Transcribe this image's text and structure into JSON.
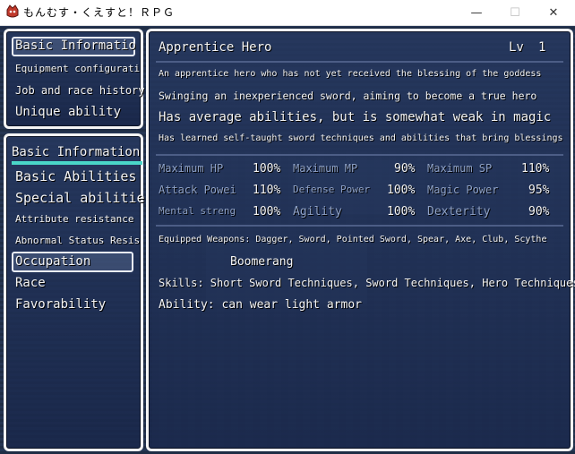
{
  "window": {
    "title": "もんむす・くえすと！ＲＰＧ",
    "minimize_glyph": "—",
    "maximize_glyph": "☐",
    "close_glyph": "✕"
  },
  "top_menu": {
    "items": [
      {
        "label": "Basic Informatio"
      },
      {
        "label": "Equipment configurati"
      },
      {
        "label": "Job and race history"
      },
      {
        "label": "Unique ability"
      }
    ]
  },
  "side_menu": {
    "header": "Basic Information",
    "items": [
      {
        "label": "Basic Abilities"
      },
      {
        "label": "Special abilitie"
      },
      {
        "label": "Attribute resistance"
      },
      {
        "label": "Abnormal Status Resis"
      },
      {
        "label": "Occupation"
      },
      {
        "label": "Race"
      },
      {
        "label": "Favorability"
      }
    ]
  },
  "detail": {
    "name": "Apprentice Hero",
    "level_label": "Lv",
    "level_value": "1",
    "desc1": "An apprentice hero who has not yet received the blessing of the goddess",
    "desc2": "Swinging an inexperienced sword, aiming to become a true hero",
    "desc3": "Has average abilities, but is somewhat weak in magic",
    "desc4": "Has learned self-taught sword techniques and abilities that bring blessings",
    "stats": [
      {
        "label": "Maximum HP",
        "value": "100%"
      },
      {
        "label": "Maximum MP",
        "value": "90%"
      },
      {
        "label": "Maximum SP",
        "value": "110%"
      },
      {
        "label": "Attack Powei",
        "value": "110%"
      },
      {
        "label": "Defense Power",
        "value": "100%"
      },
      {
        "label": "Magic Power",
        "value": "95%"
      },
      {
        "label": "Mental streng",
        "value": "100%"
      },
      {
        "label": "Agility",
        "value": "100%"
      },
      {
        "label": "Dexterity",
        "value": "90%"
      }
    ],
    "weapons": "Equipped Weapons: Dagger, Sword, Pointed Sword, Spear, Axe, Club, Scythe",
    "weapons_cont": "Boomerang",
    "skills": "Skills: Short Sword Techniques, Sword Techniques, Hero Techniques",
    "ability": "Ability: can wear light armor"
  }
}
